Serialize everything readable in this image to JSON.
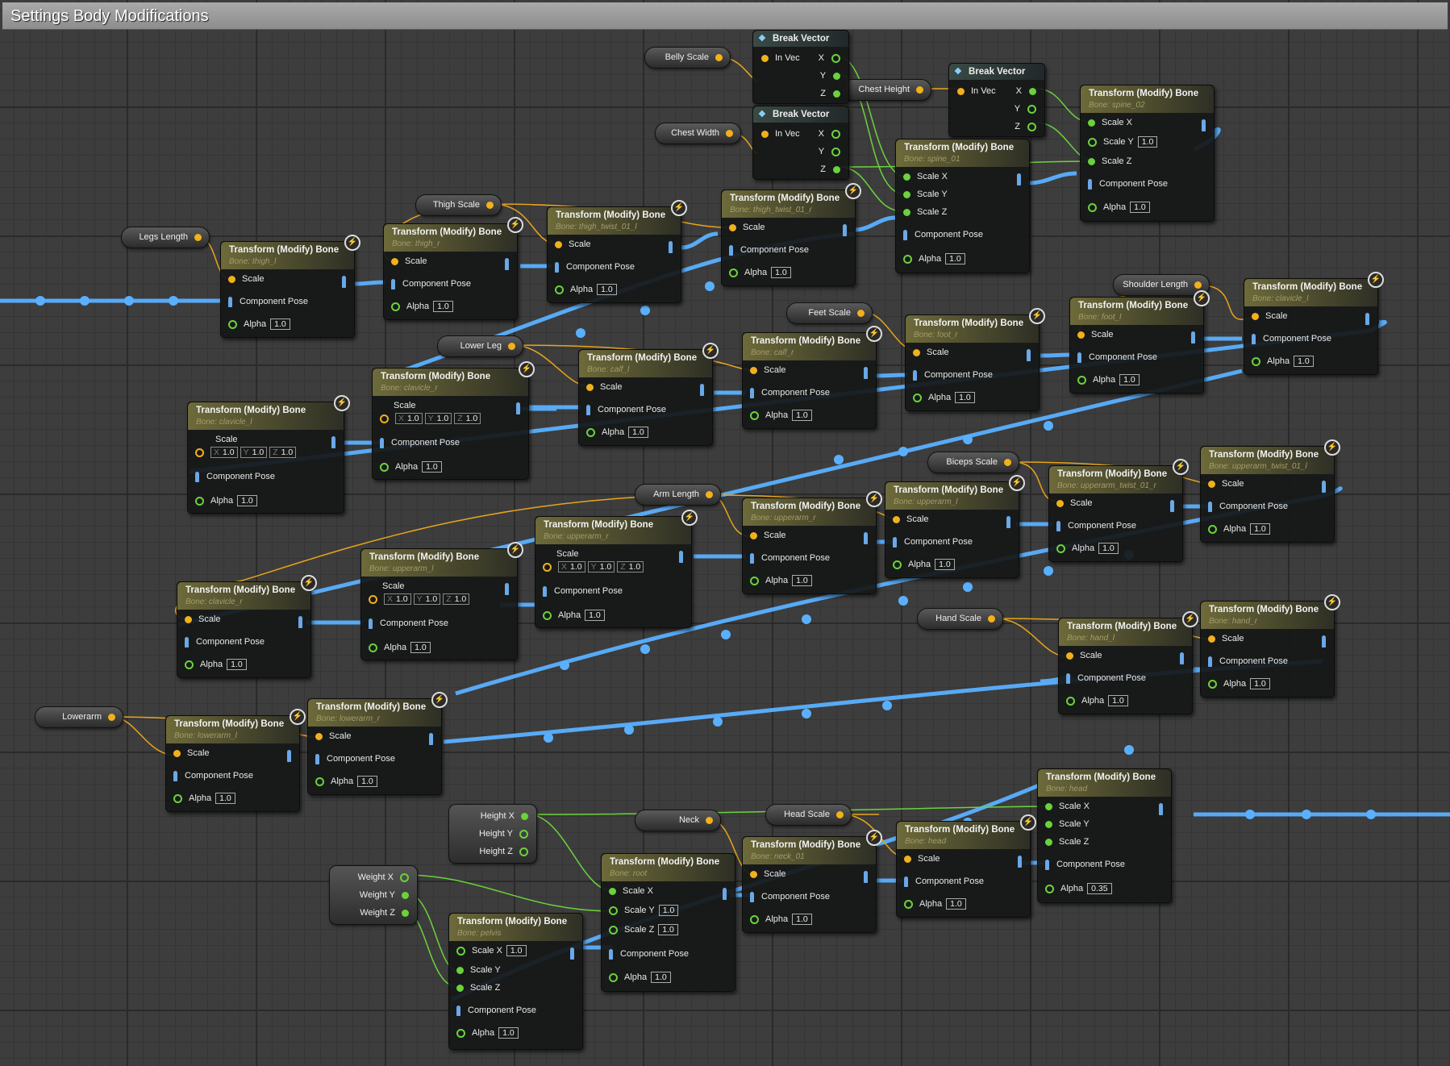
{
  "window": {
    "title": "Settings Body Modifications"
  },
  "labels": {
    "transform_title": "Transform (Modify) Bone",
    "break_vector_title": "Break Vector",
    "scale": "Scale",
    "scale_x": "Scale X",
    "scale_y": "Scale Y",
    "scale_z": "Scale Z",
    "component_pose": "Component Pose",
    "alpha": "Alpha",
    "in_vec": "In Vec",
    "x": "X",
    "y": "Y",
    "z": "Z",
    "default_value": "1.0"
  },
  "variables": {
    "belly_scale": "Belly Scale",
    "chest_width": "Chest Width",
    "chest_height": "Chest Height",
    "thigh_scale": "Thigh Scale",
    "legs_length": "Legs Length",
    "shoulder_length": "Shoulder Length",
    "feet_scale": "Feet Scale",
    "lower_leg": "Lower Leg",
    "biceps_scale": "Biceps Scale",
    "arm_length": "Arm Length",
    "hand_scale": "Hand Scale",
    "lowerarm": "Lowerarm",
    "neck": "Neck",
    "head_scale": "Head Scale",
    "height_x": "Height X",
    "height_y": "Height Y",
    "height_z": "Height Z",
    "weight_x": "Weight X",
    "weight_y": "Weight Y",
    "weight_z": "Weight Z"
  },
  "bones": {
    "spine_02": "Bone: spine_02",
    "spine_01": "Bone: spine_01",
    "thigh_twist_01_r": "Bone: thigh_twist_01_r",
    "thigh_twist_01_l": "Bone: thigh_twist_01_l",
    "thigh_r": "Bone: thigh_r",
    "thigh_l": "Bone: thigh_l",
    "clavicle_l_top": "Bone: clavicle_l",
    "foot_l": "Bone: foot_l",
    "foot_r": "Bone: foot_r",
    "calf_r": "Bone: calf_r",
    "calf_l": "Bone: calf_l",
    "clavicle_r_top": "Bone: clavicle_r",
    "clavicle_l_left": "Bone: clavicle_l",
    "upperarm_twist_01_l": "Bone: upperarm_twist_01_l",
    "upperarm_twist_01_r": "Bone: upperarm_twist_01_r",
    "upperarm_l_a": "Bone: upperarm_l",
    "upperarm_r_a": "Bone: upperarm_r",
    "upperarm_r_b": "Bone: upperarm_r",
    "upperarm_l_b": "Bone: upperarm_l",
    "clavicle_r_left": "Bone: clavicle_r",
    "hand_r": "Bone: hand_r",
    "hand_l": "Bone: hand_l",
    "lowerarm_r": "Bone: lowerarm_r",
    "lowerarm_l": "Bone: lowerarm_l",
    "head_a": "Bone: head",
    "head_b": "Bone: head",
    "neck_01": "Bone: neck_01",
    "root": "Bone: root",
    "pelvis": "Bone: pelvis"
  },
  "alpha_values": {
    "default": "1.0",
    "head": "0.35"
  },
  "colors": {
    "background": "#3d3d3d",
    "exec_wire": "#5ab0ff",
    "float_pin": "#f2b01c",
    "vector_pin": "#6bd23c"
  }
}
